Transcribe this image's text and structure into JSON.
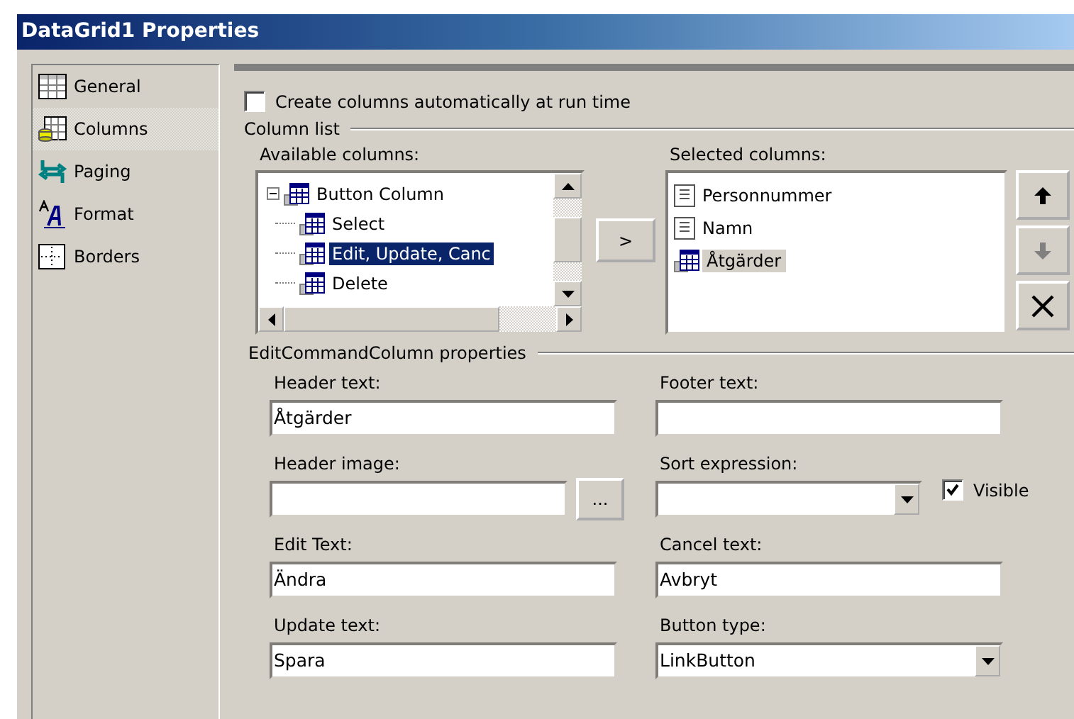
{
  "window": {
    "title": "DataGrid1 Properties"
  },
  "sidebar": {
    "items": [
      {
        "label": "General",
        "selected": false
      },
      {
        "label": "Columns",
        "selected": true
      },
      {
        "label": "Paging",
        "selected": false
      },
      {
        "label": "Format",
        "selected": false
      },
      {
        "label": "Borders",
        "selected": false
      }
    ]
  },
  "auto_columns": {
    "label": "Create columns automatically at run time",
    "checked": false
  },
  "column_list": {
    "title": "Column list",
    "available": {
      "label": "Available columns:",
      "tree": [
        {
          "label": "Button Column",
          "expanded": true,
          "selected": false,
          "children": [
            {
              "label": "Select",
              "selected": false
            },
            {
              "label": "Edit, Update, Canc",
              "selected": true
            },
            {
              "label": "Delete",
              "selected": false
            }
          ]
        }
      ]
    },
    "add_button": ">",
    "selected": {
      "label": "Selected columns:",
      "items": [
        {
          "label": "Personnummer",
          "kind": "bound",
          "selected": false
        },
        {
          "label": "Namn",
          "kind": "bound",
          "selected": false
        },
        {
          "label": "Åtgärder",
          "kind": "button",
          "selected": true
        }
      ]
    },
    "order_buttons": [
      {
        "kind": "up",
        "disabled": false
      },
      {
        "kind": "down",
        "disabled": true
      },
      {
        "kind": "delete",
        "disabled": false
      }
    ]
  },
  "properties": {
    "title": "EditCommandColumn properties",
    "fields": [
      {
        "label": "Header text:",
        "value": "Åtgärder",
        "kind": "text"
      },
      {
        "label": "Footer text:",
        "kind": "text"
      },
      {
        "label": "Header image:",
        "kind": "browse",
        "browse_label": "..."
      },
      {
        "label": "Sort expression:",
        "kind": "dropdown"
      },
      {
        "label": "Edit Text:",
        "value": "Ändra",
        "kind": "text"
      },
      {
        "label": "Cancel text:",
        "value": "Avbryt",
        "kind": "text"
      },
      {
        "label": "Update text:",
        "value": "Spara",
        "kind": "text"
      },
      {
        "label": "Button type:",
        "value": "LinkButton",
        "kind": "dropdown"
      }
    ],
    "visible": {
      "label": "Visible",
      "checked": true
    }
  }
}
